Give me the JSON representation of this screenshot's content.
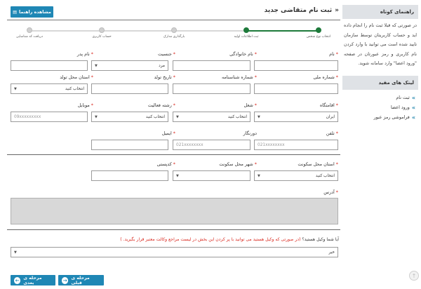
{
  "sidebar": {
    "guide_title": "راهنمای کوتاه",
    "guide_text": "در صورتی که قبلا ثبت نام را انجام داده اید و حساب کاربریتان توسط سازمان تایید شده است می توانید با وارد کردن نام کاربری و رمز عبورتان در صفحه \"ورود اعضا\" وارد سامانه شوید.",
    "links_title": "لینک های مفید",
    "links": [
      {
        "label": "ثبت نام"
      },
      {
        "label": "ورود اعضا"
      },
      {
        "label": "فراموشی رمز عبور"
      }
    ]
  },
  "header": {
    "title": "ثبت نام متقاضی جدید",
    "guide_button": "مشاهده راهنما"
  },
  "steps": [
    {
      "label": "انتخاب نوع شخص",
      "done": true
    },
    {
      "label": "ثبت اطلاعات اولیه",
      "done": true
    },
    {
      "label": "بارگذاری مدارک",
      "done": false
    },
    {
      "label": "حساب کاربری",
      "done": false
    },
    {
      "label": "دریافت کد شناسایی",
      "done": false
    }
  ],
  "form": {
    "first_name": {
      "label": "نام",
      "value": ""
    },
    "last_name": {
      "label": "نام خانوادگی",
      "value": ""
    },
    "gender": {
      "label": "جنسیت",
      "value": "مرد"
    },
    "father_name": {
      "label": "نام پدر",
      "value": ""
    },
    "national_code": {
      "label": "شماره ملی",
      "value": ""
    },
    "id_number": {
      "label": "شماره شناسنامه",
      "value": ""
    },
    "birth_date": {
      "label": "تاریخ تولد",
      "value": ""
    },
    "birth_province": {
      "label": "استان محل تولد",
      "value": "انتخاب کنید"
    },
    "nationality": {
      "label": "اقامتگاه",
      "value": "ایران"
    },
    "job": {
      "label": "شغل",
      "value": "انتخاب کنید"
    },
    "activity": {
      "label": "رشته فعالیت",
      "value": "انتخاب کنید"
    },
    "mobile": {
      "label": "موبایل",
      "placeholder": "09xxxxxxxxx"
    },
    "phone": {
      "label": "تلفن",
      "placeholder": "021xxxxxxxx"
    },
    "fax": {
      "label": "دورنگار",
      "placeholder": "021xxxxxxxx"
    },
    "email": {
      "label": "ایمیل",
      "value": ""
    },
    "res_province": {
      "label": "استان محل سکونت",
      "value": "انتخاب کنید"
    },
    "res_city": {
      "label": "شهر محل سکونت",
      "value": ""
    },
    "postal_code": {
      "label": "کدپستی",
      "value": ""
    },
    "address": {
      "label": "آدرس",
      "value": ""
    },
    "lawyer_question": "آیا شما وکیل هستید؟",
    "lawyer_note": "(در صورتی که وکیل هستید می توانید با پر کردن این بخش در لیست مراجع وکالت معتبر قرار بگیرید. )",
    "lawyer_value": "خیر"
  },
  "buttons": {
    "prev": "مرحله ی قبلی",
    "next": "مرحله ی بعدی"
  },
  "colors": {
    "accent": "#1f87b5",
    "step_done": "#1e7a3b",
    "required": "#d9261c"
  }
}
